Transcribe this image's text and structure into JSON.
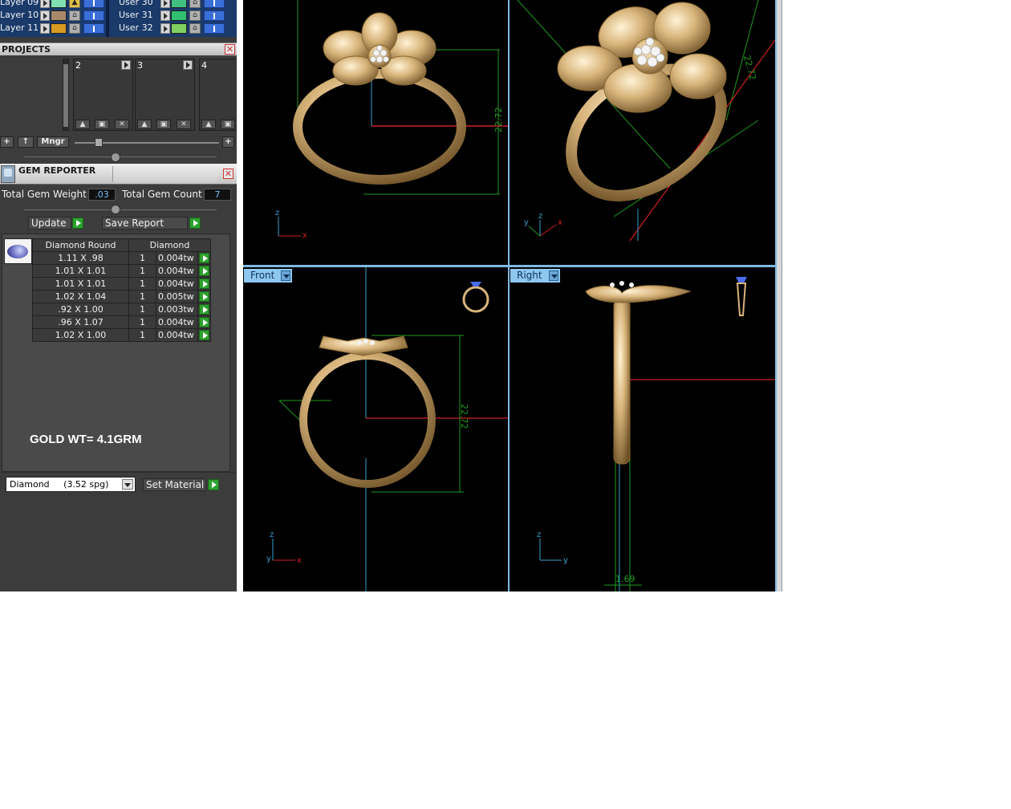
{
  "layers": {
    "left": [
      {
        "name": "Layer 09",
        "color": "#7fe0b0"
      },
      {
        "name": "Layer 10",
        "color": "#a88a6a"
      },
      {
        "name": "Layer 11",
        "color": "#d89a20"
      }
    ],
    "right": [
      {
        "name": "User 30",
        "color": "#40c080"
      },
      {
        "name": "User 31",
        "color": "#30c070"
      },
      {
        "name": "User 32",
        "color": "#80d060"
      }
    ]
  },
  "projects": {
    "title": "PROJECTS",
    "slots": [
      "2",
      "3",
      "4"
    ],
    "mngr_label": "Mngr",
    "add_label": "+",
    "up_label": "↑"
  },
  "gem_reporter": {
    "title": "GEM REPORTER",
    "total_weight_label": "Total Gem Weight",
    "total_weight_value": ".03",
    "total_count_label": "Total Gem Count",
    "total_count_value": "7",
    "update_label": "Update",
    "save_label": "Save Report",
    "table_headers": [
      "Diamond Round",
      "Diamond"
    ],
    "rows": [
      {
        "size": "1.11 X .98",
        "qty": "1",
        "weight": "0.004tw"
      },
      {
        "size": "1.01 X 1.01",
        "qty": "1",
        "weight": "0.004tw"
      },
      {
        "size": "1.01 X 1.01",
        "qty": "1",
        "weight": "0.004tw"
      },
      {
        "size": "1.02 X 1.04",
        "qty": "1",
        "weight": "0.005tw"
      },
      {
        "size": ".92 X 1.00",
        "qty": "1",
        "weight": "0.003tw"
      },
      {
        "size": ".96 X 1.07",
        "qty": "1",
        "weight": "0.004tw"
      },
      {
        "size": "1.02 X 1.00",
        "qty": "1",
        "weight": "0.004tw"
      }
    ],
    "note": "GOLD WT= 4.1GRM",
    "material_value": "Diamond     (3.52 spg)",
    "set_material_label": "Set Material"
  },
  "viewports": {
    "front_label": "Front",
    "right_label": "Right",
    "dim_height": "22.72",
    "dim_width": "1.69",
    "dim_persp": "22.72"
  },
  "colors": {
    "gold": "#d8b47a",
    "axis_red": "#d02020",
    "axis_blue": "#3aa0d0",
    "dim_green": "#1f9a1f",
    "view_tab": "#8ec8f0"
  }
}
